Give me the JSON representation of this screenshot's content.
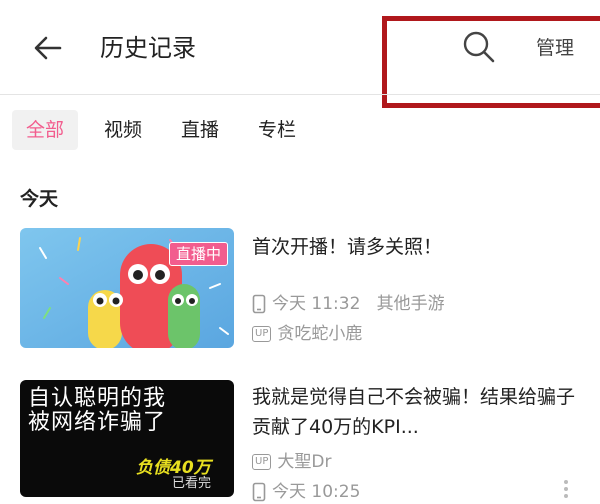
{
  "header": {
    "title": "历史记录",
    "manage_label": "管理"
  },
  "tabs": [
    {
      "label": "全部",
      "active": true
    },
    {
      "label": "视频",
      "active": false
    },
    {
      "label": "直播",
      "active": false
    },
    {
      "label": "专栏",
      "active": false
    }
  ],
  "sections": [
    {
      "label": "今天",
      "items": [
        {
          "title": "首次开播！请多关照！",
          "badge": "直播中",
          "device_icon": "phone-icon",
          "time": "今天 11:32",
          "category": "其他手游",
          "uploader": "贪吃蛇小鹿",
          "up_label": "UP"
        },
        {
          "title": "我就是觉得自己不会被骗！结果给骗子贡献了40万的KPI...",
          "thumb_text_line1": "自认聪明的我",
          "thumb_text_line2": "被网络诈骗了",
          "thumb_text_line3": "负债40万",
          "thumb_text_line4": "已看完",
          "uploader": "大聖Dr",
          "up_label": "UP",
          "device_icon": "phone-icon",
          "time": "今天 10:25"
        }
      ]
    }
  ],
  "colors": {
    "accent": "#f25d8e",
    "highlight_box": "#b0181c",
    "meta_text": "#999999"
  }
}
